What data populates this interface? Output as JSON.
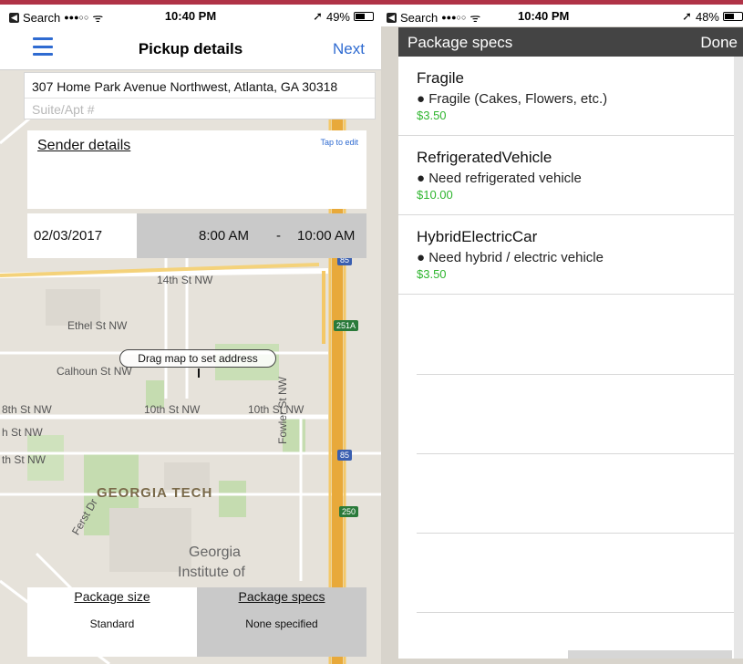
{
  "left": {
    "status": {
      "carrier": "Search",
      "signal": "●●●○○",
      "wifi": "ᯤ",
      "time": "10:40 PM",
      "location": "➚",
      "battery": "49%"
    },
    "nav": {
      "title": "Pickup details",
      "next_label": "Next"
    },
    "address": {
      "value": "307 Home Park Avenue Northwest, Atlanta, GA 30318",
      "suite_placeholder": "Suite/Apt #"
    },
    "sender": {
      "title": "Sender details",
      "tap_to_edit": "Tap to edit"
    },
    "schedule": {
      "date": "02/03/2017",
      "start": "8:00 AM",
      "dash": "-",
      "end": "10:00 AM"
    },
    "map": {
      "drag_hint": "Drag map to set address",
      "labels": [
        "14th St NW",
        "Ethel St NW",
        "Calhoun St NW",
        "10th St NW",
        "10th St NW",
        "h St NW",
        "th St NW",
        "8th St NW",
        "GEORGIA TECH",
        "Georgia",
        "Institute of",
        "Fowler St NW",
        "Ferst Dr"
      ],
      "shields": [
        "85",
        "251A",
        "85",
        "250"
      ]
    },
    "package": {
      "size_label": "Package size",
      "size_value": "Standard",
      "specs_label": "Package specs",
      "specs_value": "None specified"
    }
  },
  "right": {
    "status": {
      "carrier": "Search",
      "signal": "●●●○○",
      "wifi": "ᯤ",
      "time": "10:40 PM",
      "location": "➚",
      "battery": "48%"
    },
    "sheet": {
      "title": "Package specs",
      "done_label": "Done"
    },
    "specs": [
      {
        "name": "Fragile",
        "desc": "● Fragile (Cakes, Flowers, etc.)",
        "price": "$3.50"
      },
      {
        "name": "RefrigeratedVehicle",
        "desc": "● Need refrigerated vehicle",
        "price": "$10.00"
      },
      {
        "name": "HybridElectricCar",
        "desc": "● Need hybrid / electric vehicle",
        "price": "$3.50"
      }
    ]
  },
  "colors": {
    "accent": "#2f6bd1",
    "price_green": "#2fb52f",
    "header_dark": "#444444",
    "top_line": "#b03347"
  }
}
